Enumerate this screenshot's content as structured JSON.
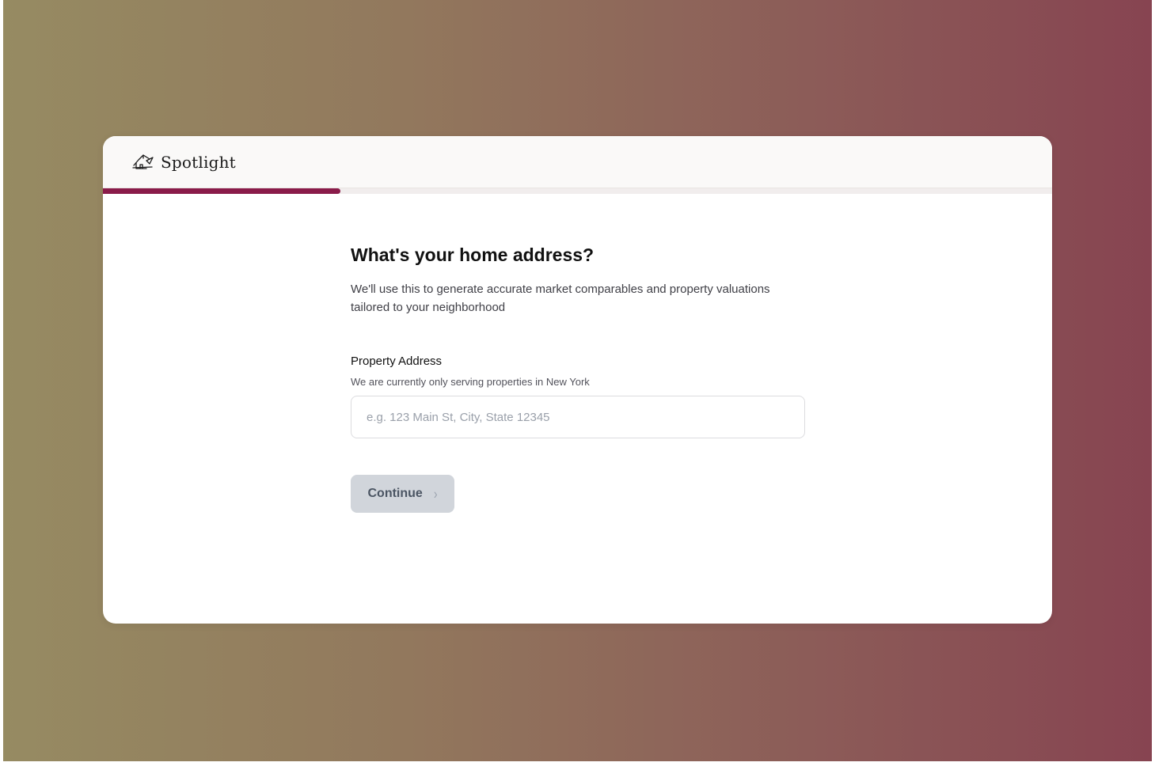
{
  "brand": {
    "name": "Spotlight",
    "icon": "house-logo-icon"
  },
  "progress": {
    "fraction": 0.25,
    "color": "#8a1c4a"
  },
  "step": {
    "question": "What's your home address?",
    "description": "We'll use this to generate accurate market comparables and property valuations tailored to your neighborhood"
  },
  "address_field": {
    "label": "Property Address",
    "hint": "We are currently only serving properties in New York",
    "value": "",
    "placeholder": "e.g. 123 Main St, City, State 12345"
  },
  "continue_button": {
    "label": "Continue",
    "icon": "chevron-right-icon",
    "disabled": true
  }
}
